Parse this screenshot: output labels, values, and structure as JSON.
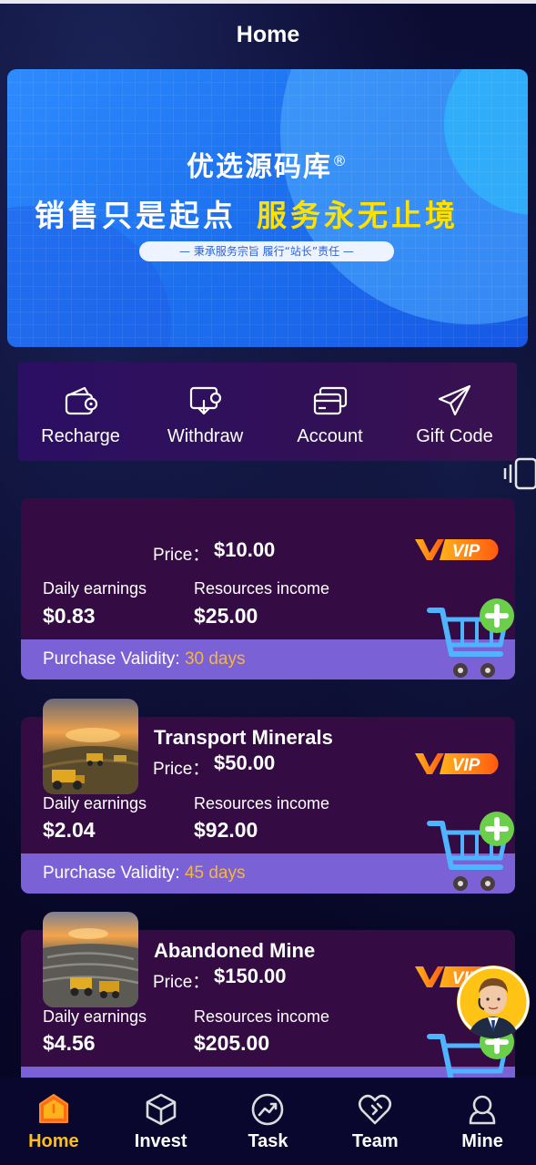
{
  "header": {
    "title": "Home"
  },
  "banner": {
    "brand": "优选源码库",
    "registered_mark": "®",
    "slogan_white": "销售只是起点",
    "slogan_yellow": "服务永无止境",
    "pill_text": "— 秉承服务宗旨 履行“站长”责任 —"
  },
  "quick_actions": [
    {
      "label": "Recharge",
      "icon": "wallet-icon"
    },
    {
      "label": "Withdraw",
      "icon": "withdraw-icon"
    },
    {
      "label": "Account",
      "icon": "cards-icon"
    },
    {
      "label": "Gift Code",
      "icon": "paper-plane-icon"
    }
  ],
  "products": [
    {
      "name": "",
      "price_label": "Price：",
      "price": "$10.00",
      "vip_badge": "VIP",
      "daily_label": "Daily earnings",
      "daily_value": "$0.83",
      "resources_label": "Resources income",
      "resources_value": "$25.00",
      "validity_label": "Purchase Validity:",
      "validity_value": "30 days"
    },
    {
      "name": "Transport Minerals",
      "price_label": "Price：",
      "price": "$50.00",
      "vip_badge": "VIP",
      "daily_label": "Daily earnings",
      "daily_value": "$2.04",
      "resources_label": "Resources income",
      "resources_value": "$92.00",
      "validity_label": "Purchase Validity:",
      "validity_value": "45 days"
    },
    {
      "name": "Abandoned Mine",
      "price_label": "Price：",
      "price": "$150.00",
      "vip_badge": "VIP",
      "daily_label": "Daily earnings",
      "daily_value": "$4.56",
      "resources_label": "Resources income",
      "resources_value": "$205.00"
    }
  ],
  "nav": [
    {
      "label": "Home",
      "icon": "home-icon",
      "active": true
    },
    {
      "label": "Invest",
      "icon": "cube-icon",
      "active": false
    },
    {
      "label": "Task",
      "icon": "trend-icon",
      "active": false
    },
    {
      "label": "Team",
      "icon": "heart-icon",
      "active": false
    },
    {
      "label": "Mine",
      "icon": "user-icon",
      "active": false
    }
  ],
  "colors": {
    "background": "#07062a",
    "card": "#350b44",
    "validity_bar": "#7a62d6",
    "accent_orange": "#f6b63c",
    "nav_active": "#ffbf18",
    "banner_blue": "#1d72f0"
  }
}
